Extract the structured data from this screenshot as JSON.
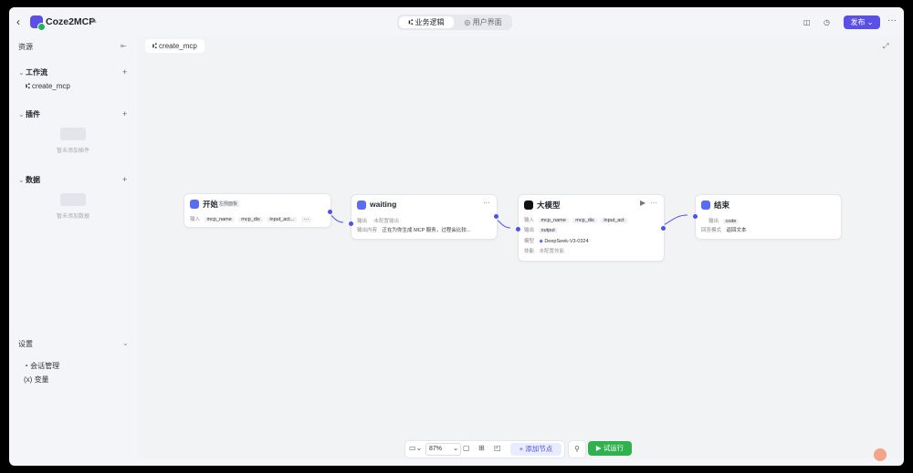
{
  "header": {
    "back": "‹",
    "title": "Coze2MCP",
    "tabs": [
      {
        "label": "业务逻辑",
        "icon": "⑆"
      },
      {
        "label": "用户界面",
        "icon": "◎"
      }
    ],
    "publish_label": "发布",
    "more": "···"
  },
  "sidebar": {
    "title": "资源",
    "sections": [
      {
        "label": "工作流",
        "items": [
          "create_mcp"
        ]
      },
      {
        "label": "插件",
        "empty_text": "暂未添加插件"
      },
      {
        "label": "数据",
        "empty_text": "暂未添加数据"
      }
    ],
    "settings": {
      "label": "设置",
      "items": [
        "会话管理",
        "变量"
      ]
    }
  },
  "canvas": {
    "tab_label": "create_mcp",
    "nodes": {
      "start": {
        "title": "开始",
        "badge": "左侧面板",
        "input_label": "输入",
        "params": [
          "mcp_name",
          "mcp_dis",
          "input_act..."
        ],
        "more": "···"
      },
      "waiting": {
        "title": "waiting",
        "output_label": "输出",
        "output_value": "未配置输出",
        "content_label": "输出内容",
        "content_value": "正在为你生成 MCP 服务，过程会比较...",
        "more": "···"
      },
      "llm": {
        "title": "大模型",
        "input_label": "输入",
        "params": [
          "mcp_name",
          "mcp_dis",
          "input_act"
        ],
        "output_label": "输出",
        "output_param": "output",
        "model_label": "模型",
        "model_value": "DeepSeek-V3-0324",
        "skill_label": "技能",
        "skill_value": "未配置技能",
        "run": "▶",
        "more": "···"
      },
      "end": {
        "title": "结束",
        "output_label": "输出",
        "output_param": "code",
        "mode_label": "回答模式",
        "mode_value": "返回文本"
      }
    }
  },
  "toolbar": {
    "zoom": "87%",
    "add_node_label": "添加节点",
    "test_run_label": "试运行"
  },
  "colors": {
    "accent": "#4d53e8",
    "publish": "#5a4fe6",
    "run": "#2fb14f"
  }
}
